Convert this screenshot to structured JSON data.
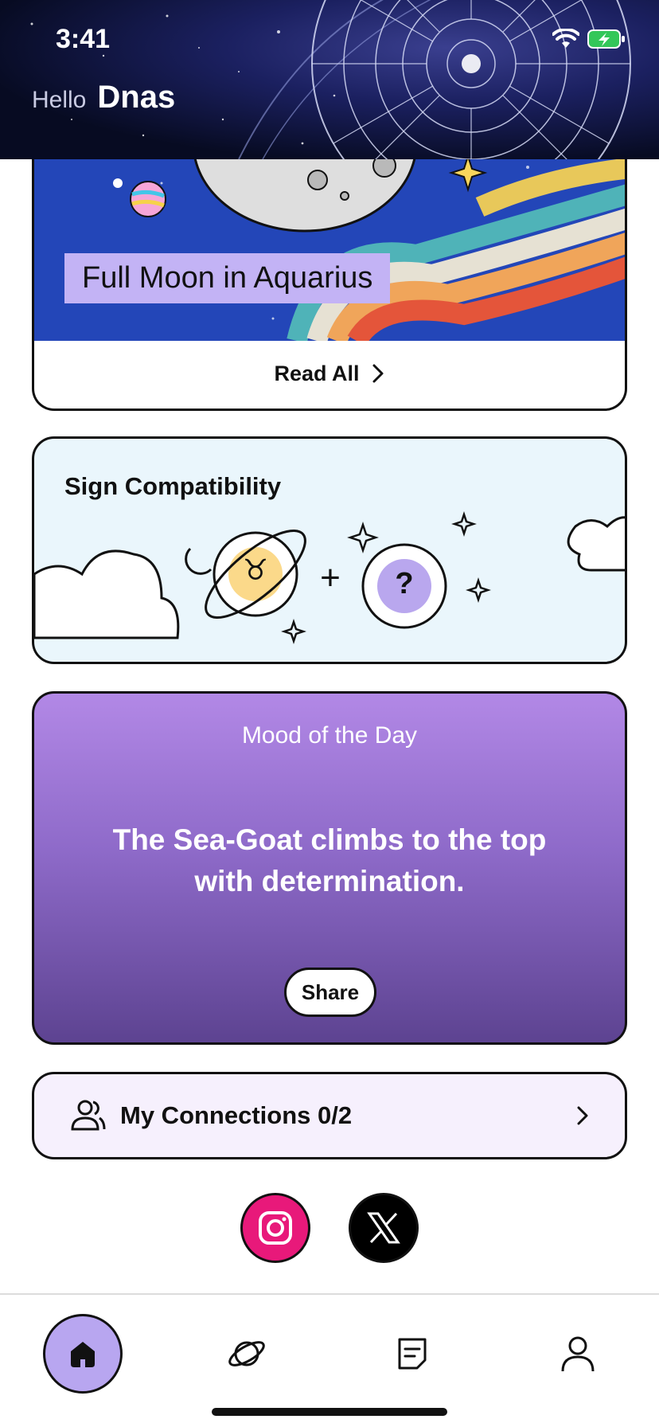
{
  "status_bar": {
    "time": "3:41"
  },
  "header": {
    "greeting": "Hello",
    "user_name": "Dnas"
  },
  "news_card": {
    "title": "Full Moon in Aquarius",
    "read_all_label": "Read All"
  },
  "compatibility_card": {
    "title": "Sign Compatibility",
    "sign_symbol": "♉",
    "unknown_symbol": "?",
    "plus_symbol": "+"
  },
  "mood_card": {
    "label": "Mood of the Day",
    "text": "The Sea-Goat climbs to the top with determination.",
    "share_label": "Share"
  },
  "connections": {
    "label": "My Connections 0/2"
  },
  "social": [
    {
      "name": "instagram-icon",
      "color": "#e8197a"
    },
    {
      "name": "x-icon",
      "color": "#000000"
    }
  ],
  "tabbar": {
    "tabs": [
      "home-icon",
      "planet-icon",
      "notes-icon",
      "profile-icon"
    ],
    "active": "home"
  },
  "colors": {
    "accent_lavender": "#b8a6f0",
    "mood_gradient_top": "#b288e6",
    "mood_gradient_bottom": "#5d4391",
    "compat_bg": "#eaf6fc",
    "news_bg": "#2346b8"
  }
}
